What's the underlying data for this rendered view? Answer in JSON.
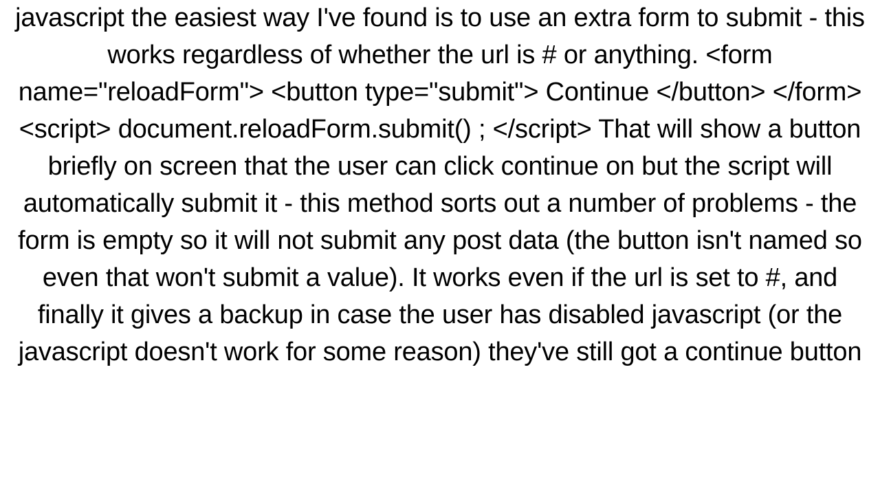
{
  "document": {
    "body": "javascript the easiest way I've found is to use an extra form to submit - this works regardless of whether the url is # or anything. <form name=\"reloadForm\">     <button type=\"submit\">         Continue     </button> </form> <script>     document.reloadForm.submit() ; </script>  That will show a button briefly on screen that the user can click continue on but the script will automatically submit it  - this method sorts out a number of problems - the form is empty so it will not submit any post data (the button isn't named so even that won't submit a value).  It works even if the url is set to #, and finally it gives a backup in case the user has disabled javascript (or the javascript doesn't work for some reason) they've still got a continue button"
  }
}
